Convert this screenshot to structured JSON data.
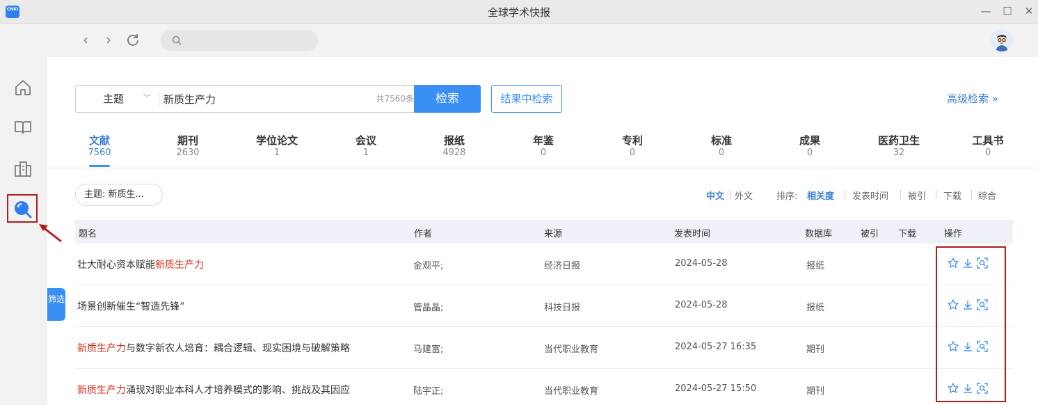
{
  "window": {
    "title": "全球学术快报",
    "logo_text": "CNKI"
  },
  "search": {
    "field": "主题",
    "query": "新质生产力",
    "total": "共7560条",
    "search_label": "检索",
    "refine_label": "结果中检索",
    "advanced_label": "高级检索 »"
  },
  "db_tabs": [
    {
      "label": "文献",
      "count": "7560",
      "active": true
    },
    {
      "label": "期刊",
      "count": "2630"
    },
    {
      "label": "学位论文",
      "count": "1"
    },
    {
      "label": "会议",
      "count": "1"
    },
    {
      "label": "报纸",
      "count": "4928"
    },
    {
      "label": "年鉴",
      "count": "0"
    },
    {
      "label": "专利",
      "count": "0"
    },
    {
      "label": "标准",
      "count": "0"
    },
    {
      "label": "成果",
      "count": "0"
    },
    {
      "label": "医药卫生",
      "count": "32"
    },
    {
      "label": "工具书",
      "count": "0"
    }
  ],
  "filter": {
    "tab_label": "筛选",
    "chip": "主题: 新质生..."
  },
  "sorting": {
    "lang_zh": "中文",
    "lang_en": "外文",
    "label": "排序:",
    "options": [
      "相关度",
      "发表时间",
      "被引",
      "下载",
      "综合"
    ],
    "active": "相关度"
  },
  "table": {
    "headers": [
      "题名",
      "作者",
      "来源",
      "发表时间",
      "数据库",
      "被引",
      "下载",
      "操作"
    ],
    "rows": [
      {
        "title_pre": "壮大耐心资本赋能",
        "title_hl": "新质生产力",
        "title_post": "",
        "author": "金观平;",
        "source": "经济日报",
        "date": "2024-05-28",
        "db": "报纸"
      },
      {
        "title_pre": "场景创新催生“智造先锋”",
        "title_hl": "",
        "title_post": "",
        "author": "管晶晶;",
        "source": "科技日报",
        "date": "2024-05-28",
        "db": "报纸"
      },
      {
        "title_pre": "",
        "title_hl": "新质生产力",
        "title_post": "与数字新农人培育：耦合逻辑、现实困境与破解策略",
        "author": "马建富;",
        "source": "当代职业教育",
        "date": "2024-05-27 16:35",
        "db": "期刊"
      },
      {
        "title_pre": "",
        "title_hl": "新质生产力",
        "title_post": "涌现对职业本科人才培养模式的影响、挑战及其因应",
        "author": "陆宇正;",
        "source": "当代职业教育",
        "date": "2024-05-27 15:50",
        "db": "期刊"
      }
    ]
  },
  "colors": {
    "accent": "#3a8ff5",
    "highlight_text": "#d52b1e",
    "annotation": "#b31b1b"
  }
}
